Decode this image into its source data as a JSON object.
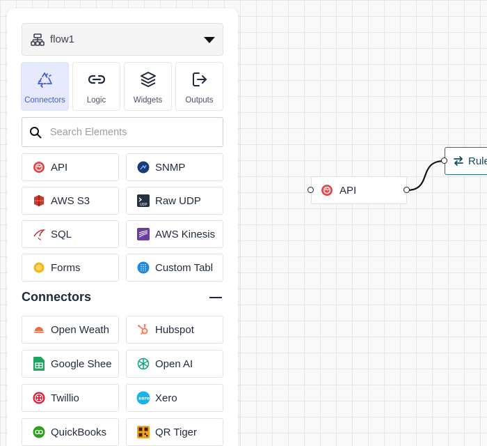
{
  "flow": {
    "name": "flow1"
  },
  "tabs": [
    {
      "label": "Connectors",
      "icon": "recycle-icon",
      "active": true
    },
    {
      "label": "Logic",
      "icon": "link-icon",
      "active": false
    },
    {
      "label": "Widgets",
      "icon": "layers-icon",
      "active": false
    },
    {
      "label": "Outputs",
      "icon": "logout-icon",
      "active": false
    }
  ],
  "search": {
    "placeholder": "Search Elements",
    "value": ""
  },
  "elements": [
    {
      "label": "API",
      "icon": "api-icon"
    },
    {
      "label": "SNMP",
      "icon": "snmp-icon"
    },
    {
      "label": "AWS S3",
      "icon": "aws-s3-icon"
    },
    {
      "label": "Raw UDP",
      "icon": "terminal-icon"
    },
    {
      "label": "SQL",
      "icon": "sql-icon"
    },
    {
      "label": "AWS Kinesis",
      "icon": "aws-kinesis-icon"
    },
    {
      "label": "Forms",
      "icon": "forms-icon"
    },
    {
      "label": "Custom Tabl",
      "icon": "custom-table-icon"
    }
  ],
  "connectors_section": {
    "title": "Connectors",
    "collapsed": false
  },
  "connectors": [
    {
      "label": "Open Weath",
      "icon": "weather-icon"
    },
    {
      "label": "Hubspot",
      "icon": "hubspot-icon"
    },
    {
      "label": "Google Shee",
      "icon": "google-sheets-icon"
    },
    {
      "label": "Open AI",
      "icon": "openai-icon"
    },
    {
      "label": "Twillio",
      "icon": "twilio-icon"
    },
    {
      "label": "Xero",
      "icon": "xero-icon"
    },
    {
      "label": "QuickBooks",
      "icon": "quickbooks-icon"
    },
    {
      "label": "QR Tiger",
      "icon": "qr-tiger-icon"
    }
  ],
  "canvas": {
    "nodes": [
      {
        "label": "API",
        "icon": "api-icon"
      },
      {
        "label": "Rule",
        "icon": "swap-icon"
      }
    ]
  }
}
